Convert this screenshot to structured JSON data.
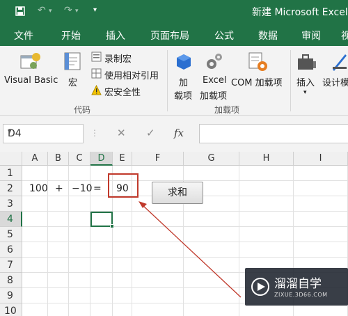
{
  "titlebar": {
    "save_icon": "save-icon",
    "undo_icon": "undo-icon",
    "redo_icon": "redo-icon",
    "customize_icon": "dropdown-icon",
    "title": "新建 Microsoft Excel 工"
  },
  "menu": {
    "tabs": [
      "文件",
      "开始",
      "插入",
      "页面布局",
      "公式",
      "数据",
      "审阅",
      "视"
    ]
  },
  "ribbon": {
    "visual_basic": "Visual Basic",
    "macro": "宏",
    "record_macro": "录制宏",
    "relative_ref": "使用相对引用",
    "macro_security": "宏安全性",
    "group_code": "代码",
    "addins_line1": "加",
    "addins_line2": "载项",
    "excel_addins_line1": "Excel",
    "excel_addins_line2": "加载项",
    "com_addins": "COM 加载项",
    "group_addins": "加载项",
    "insert": "插入",
    "design_mode": "设计模",
    "warning_icon": "warning-icon"
  },
  "formula_bar": {
    "name_box": "D4",
    "cancel_symbol": "✕",
    "enter_symbol": "✓",
    "fx_symbol": "fx",
    "formula": ""
  },
  "sheet": {
    "columns": [
      "A",
      "B",
      "C",
      "D",
      "E",
      "F",
      "G",
      "H",
      "I"
    ],
    "rows": [
      "1",
      "2",
      "3",
      "4",
      "5",
      "6",
      "7",
      "8",
      "9",
      "10"
    ],
    "cells": {
      "A2": "100",
      "B2": "+",
      "C2": "−10",
      "D2": "=",
      "E2": "90"
    },
    "active_cell": "D4",
    "button_label": "求和"
  },
  "watermark": {
    "brand": "溜溜自学",
    "url": "ZIXUE.3D66.COM"
  },
  "colors": {
    "brand_green": "#217346",
    "annotation_red": "#c0392b"
  }
}
